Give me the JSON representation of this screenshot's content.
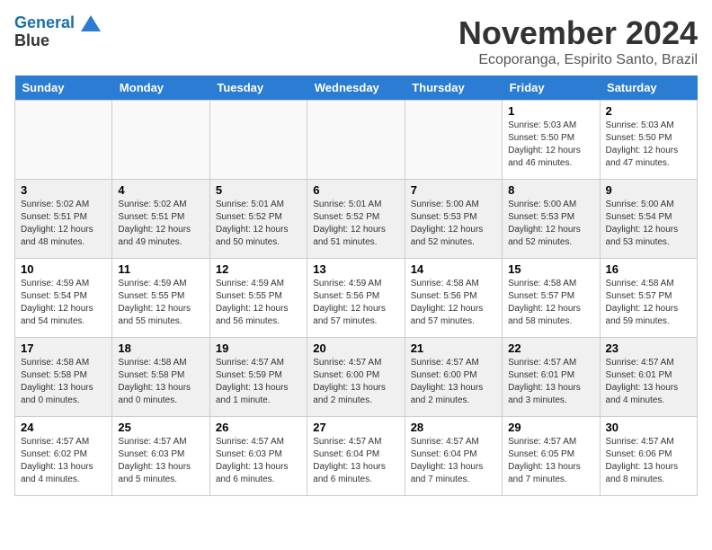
{
  "header": {
    "logo_line1": "General",
    "logo_line2": "Blue",
    "month": "November 2024",
    "location": "Ecoporanga, Espirito Santo, Brazil"
  },
  "days_of_week": [
    "Sunday",
    "Monday",
    "Tuesday",
    "Wednesday",
    "Thursday",
    "Friday",
    "Saturday"
  ],
  "weeks": [
    [
      {
        "day": "",
        "info": ""
      },
      {
        "day": "",
        "info": ""
      },
      {
        "day": "",
        "info": ""
      },
      {
        "day": "",
        "info": ""
      },
      {
        "day": "",
        "info": ""
      },
      {
        "day": "1",
        "info": "Sunrise: 5:03 AM\nSunset: 5:50 PM\nDaylight: 12 hours\nand 46 minutes."
      },
      {
        "day": "2",
        "info": "Sunrise: 5:03 AM\nSunset: 5:50 PM\nDaylight: 12 hours\nand 47 minutes."
      }
    ],
    [
      {
        "day": "3",
        "info": "Sunrise: 5:02 AM\nSunset: 5:51 PM\nDaylight: 12 hours\nand 48 minutes."
      },
      {
        "day": "4",
        "info": "Sunrise: 5:02 AM\nSunset: 5:51 PM\nDaylight: 12 hours\nand 49 minutes."
      },
      {
        "day": "5",
        "info": "Sunrise: 5:01 AM\nSunset: 5:52 PM\nDaylight: 12 hours\nand 50 minutes."
      },
      {
        "day": "6",
        "info": "Sunrise: 5:01 AM\nSunset: 5:52 PM\nDaylight: 12 hours\nand 51 minutes."
      },
      {
        "day": "7",
        "info": "Sunrise: 5:00 AM\nSunset: 5:53 PM\nDaylight: 12 hours\nand 52 minutes."
      },
      {
        "day": "8",
        "info": "Sunrise: 5:00 AM\nSunset: 5:53 PM\nDaylight: 12 hours\nand 52 minutes."
      },
      {
        "day": "9",
        "info": "Sunrise: 5:00 AM\nSunset: 5:54 PM\nDaylight: 12 hours\nand 53 minutes."
      }
    ],
    [
      {
        "day": "10",
        "info": "Sunrise: 4:59 AM\nSunset: 5:54 PM\nDaylight: 12 hours\nand 54 minutes."
      },
      {
        "day": "11",
        "info": "Sunrise: 4:59 AM\nSunset: 5:55 PM\nDaylight: 12 hours\nand 55 minutes."
      },
      {
        "day": "12",
        "info": "Sunrise: 4:59 AM\nSunset: 5:55 PM\nDaylight: 12 hours\nand 56 minutes."
      },
      {
        "day": "13",
        "info": "Sunrise: 4:59 AM\nSunset: 5:56 PM\nDaylight: 12 hours\nand 57 minutes."
      },
      {
        "day": "14",
        "info": "Sunrise: 4:58 AM\nSunset: 5:56 PM\nDaylight: 12 hours\nand 57 minutes."
      },
      {
        "day": "15",
        "info": "Sunrise: 4:58 AM\nSunset: 5:57 PM\nDaylight: 12 hours\nand 58 minutes."
      },
      {
        "day": "16",
        "info": "Sunrise: 4:58 AM\nSunset: 5:57 PM\nDaylight: 12 hours\nand 59 minutes."
      }
    ],
    [
      {
        "day": "17",
        "info": "Sunrise: 4:58 AM\nSunset: 5:58 PM\nDaylight: 13 hours\nand 0 minutes."
      },
      {
        "day": "18",
        "info": "Sunrise: 4:58 AM\nSunset: 5:58 PM\nDaylight: 13 hours\nand 0 minutes."
      },
      {
        "day": "19",
        "info": "Sunrise: 4:57 AM\nSunset: 5:59 PM\nDaylight: 13 hours\nand 1 minute."
      },
      {
        "day": "20",
        "info": "Sunrise: 4:57 AM\nSunset: 6:00 PM\nDaylight: 13 hours\nand 2 minutes."
      },
      {
        "day": "21",
        "info": "Sunrise: 4:57 AM\nSunset: 6:00 PM\nDaylight: 13 hours\nand 2 minutes."
      },
      {
        "day": "22",
        "info": "Sunrise: 4:57 AM\nSunset: 6:01 PM\nDaylight: 13 hours\nand 3 minutes."
      },
      {
        "day": "23",
        "info": "Sunrise: 4:57 AM\nSunset: 6:01 PM\nDaylight: 13 hours\nand 4 minutes."
      }
    ],
    [
      {
        "day": "24",
        "info": "Sunrise: 4:57 AM\nSunset: 6:02 PM\nDaylight: 13 hours\nand 4 minutes."
      },
      {
        "day": "25",
        "info": "Sunrise: 4:57 AM\nSunset: 6:03 PM\nDaylight: 13 hours\nand 5 minutes."
      },
      {
        "day": "26",
        "info": "Sunrise: 4:57 AM\nSunset: 6:03 PM\nDaylight: 13 hours\nand 6 minutes."
      },
      {
        "day": "27",
        "info": "Sunrise: 4:57 AM\nSunset: 6:04 PM\nDaylight: 13 hours\nand 6 minutes."
      },
      {
        "day": "28",
        "info": "Sunrise: 4:57 AM\nSunset: 6:04 PM\nDaylight: 13 hours\nand 7 minutes."
      },
      {
        "day": "29",
        "info": "Sunrise: 4:57 AM\nSunset: 6:05 PM\nDaylight: 13 hours\nand 7 minutes."
      },
      {
        "day": "30",
        "info": "Sunrise: 4:57 AM\nSunset: 6:06 PM\nDaylight: 13 hours\nand 8 minutes."
      }
    ]
  ]
}
